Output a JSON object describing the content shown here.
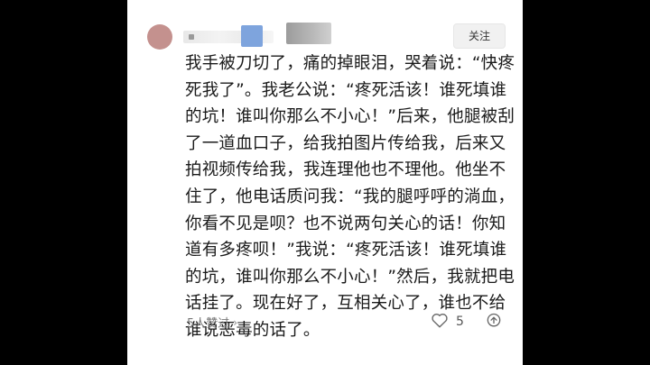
{
  "post": {
    "follow_label": "关注",
    "content_lines": [
      "我手被刀切了，痛的掉眼泪，哭着说：“快疼",
      "死我了”。我老公说：“疼死活该！谁死填谁",
      "的坑！谁叫你那么不小心！”后来，他腿被刮",
      "了一道血口子，给我拍图片传给我，后来又",
      "拍视频传给我，我连理他也不理他。他坐不",
      "住了，他电话质问我：“我的腿呼呼的淌血，",
      "你看不见是呗？也不说两句关心的话！你知",
      "道有多疼呗！”我说：“疼死活该！谁死填谁",
      "的坑，谁叫你那么不小心！”然后，我就把电",
      "话挂了。现在好了，互相关心了，谁也不给",
      "谁说恶毒的话了。"
    ],
    "likes_text": "5人赞过",
    "likes_chevron": "›",
    "like_count": "5"
  },
  "icons": {
    "heart": "heart-icon",
    "share": "share-icon"
  },
  "colors": {
    "background": "#000000",
    "card": "#ffffff",
    "text": "#1a1a1a",
    "muted": "#777777"
  }
}
